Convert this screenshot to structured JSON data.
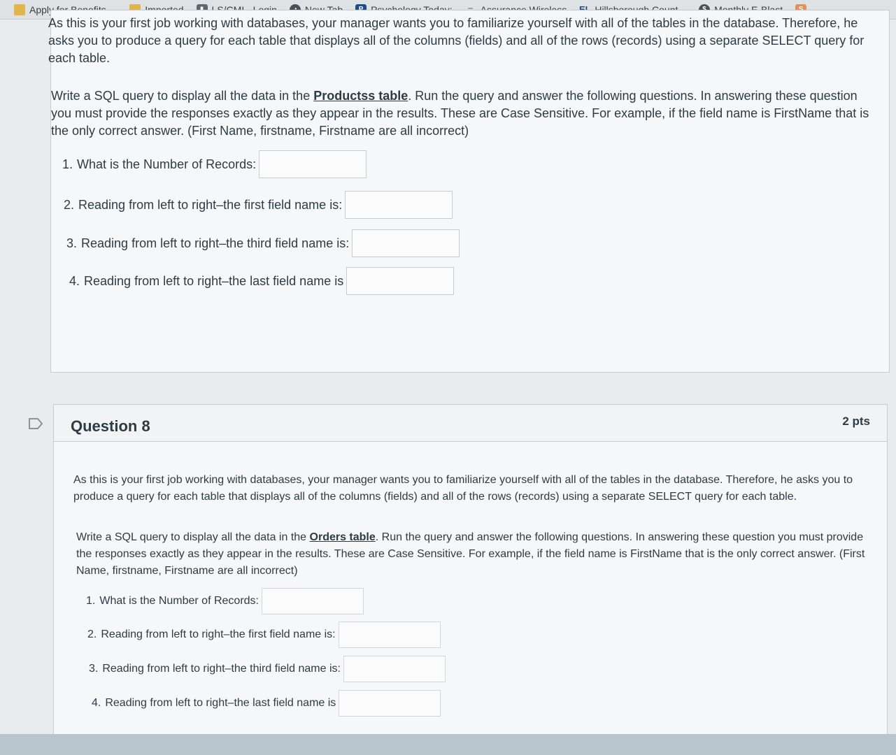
{
  "bookmarks": [
    {
      "label": "Apply for Benefits,...",
      "icon": "folder-icon"
    },
    {
      "label": "Imported",
      "icon": "folder-icon"
    },
    {
      "label": "LS/CMI - Login",
      "icon": "lscmi-icon"
    },
    {
      "label": "New Tab",
      "icon": "newtab-icon"
    },
    {
      "label": "Psychology Today:",
      "icon": "pt-icon"
    },
    {
      "label": "Assurance Wireless",
      "icon": "aw-icon"
    },
    {
      "label": "Hillsborough Count...",
      "icon": "el-icon"
    },
    {
      "label": "Monthly E-Blast",
      "icon": "meb-icon"
    }
  ],
  "q7": {
    "intro": "As this is your first job working with databases, your manager wants you to familiarize yourself with all of the tables in the database.  Therefore, he asks you to produce a query for each table that displays all of the columns (fields) and all of the rows (records) using a separate SELECT query for each table.",
    "instr_before": "Write a SQL query to display all the data in the ",
    "table_link": "Productss table",
    "instr_after": ". Run the query and answer the following questions. In answering these question you must provide the responses exactly as they appear in the results.  These are Case Sensitive. For example, if the field name is FirstName that is the only correct answer.  (First Name, firstname, Firstname are all incorrect)",
    "items": [
      {
        "num": "1.",
        "label": "What is the Number of Records:"
      },
      {
        "num": "2.",
        "label": "Reading from left to right–the first field name is:"
      },
      {
        "num": "3.",
        "label": "Reading from left to right–the third field name is:"
      },
      {
        "num": "4.",
        "label": "Reading from left to right–the last field name is"
      }
    ]
  },
  "q8": {
    "title": "Question 8",
    "points": "2 pts",
    "intro": "As this is your first job working with databases, your manager wants you to familiarize yourself with all of the tables in the database.  Therefore, he asks you to produce a query for each table that displays all of the columns (fields) and all of the rows (records) using a separate SELECT query for each table.",
    "instr_before": "Write a SQL query to display all the data in the ",
    "table_link": "Orders table",
    "instr_after": ". Run the query and answer the following questions. In answering these question you must provide the responses exactly as they appear in the results.  These are Case Sensitive. For example, if the field name is FirstName that is the only correct answer.  (First Name, firstname, Firstname are all incorrect)",
    "items": [
      {
        "num": "1.",
        "label": "What is the Number of Records:"
      },
      {
        "num": "2.",
        "label": "Reading from left to right–the first field name is:"
      },
      {
        "num": "3.",
        "label": "Reading from left to right–the third field name is:"
      },
      {
        "num": "4.",
        "label": "Reading from left to right–the last field name is"
      }
    ]
  }
}
